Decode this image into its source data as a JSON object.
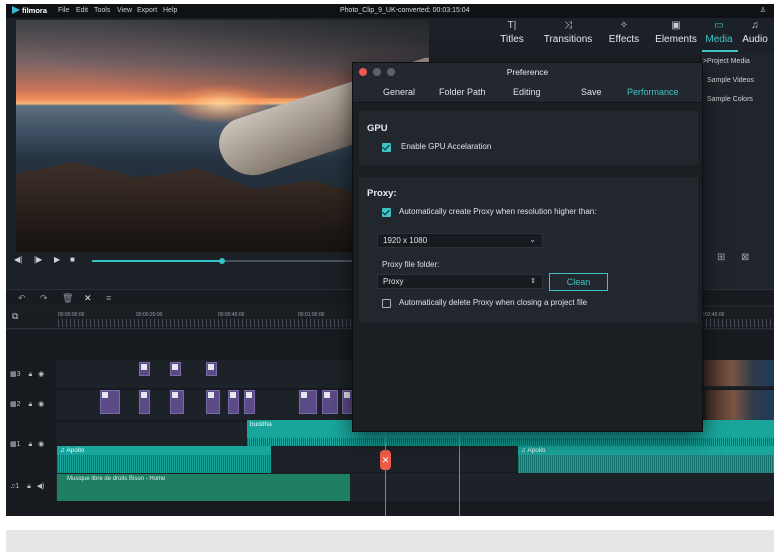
{
  "menubar": {
    "logo": "filmora",
    "items": [
      "File",
      "Edit",
      "Tools",
      "View",
      "Export",
      "Help"
    ],
    "window_title": "Photo_Clip_9_UK-converted:  00:03:15:04"
  },
  "top_tabs": [
    {
      "label": "Titles",
      "icon": "T|"
    },
    {
      "label": "Transitions",
      "icon": "⤨"
    },
    {
      "label": "Effects",
      "icon": "✧"
    },
    {
      "label": "Elements",
      "icon": "▣"
    },
    {
      "label": "Media",
      "icon": "▭"
    },
    {
      "label": "Audio",
      "icon": "♫"
    }
  ],
  "media_sidebar": [
    "Project Media",
    "Sample Videos",
    "Sample Colors"
  ],
  "ruler": {
    "timecodes": [
      "00:00:00:00",
      "00:00:20:00",
      "00:00:40:00",
      "00:01:00:00",
      "00:02:40:00"
    ]
  },
  "tracks": {
    "video3": "3",
    "video2": "2",
    "video1": "1",
    "audio1": "1",
    "clips": {
      "buddha": "buddha",
      "apollo_a": "Apollo",
      "apollo_b": "Apollo",
      "music": "Musique libre de droits Bison - Home"
    }
  },
  "preference": {
    "title": "Preference",
    "tabs": [
      "General",
      "Folder Path",
      "Editing",
      "Save",
      "Performance"
    ],
    "active_tab": "Performance",
    "gpu": {
      "title": "GPU",
      "enable_label": "Enable GPU Accelaration",
      "enabled": true
    },
    "proxy": {
      "title": "Proxy:",
      "auto_create_label": "Automatically create Proxy when resolution higher than:",
      "auto_create": true,
      "resolution": "1920 x 1080",
      "folder_label": "Proxy file folder:",
      "folder": "Proxy",
      "clean_label": "Clean",
      "auto_delete_label": "Automatically delete Proxy when closing a project file",
      "auto_delete": false
    }
  },
  "colors": {
    "accent": "#3fc3c8",
    "playhead": "#ee5b4a",
    "audio_clip": "#1aa59c",
    "title_clip": "#5a4a86"
  }
}
